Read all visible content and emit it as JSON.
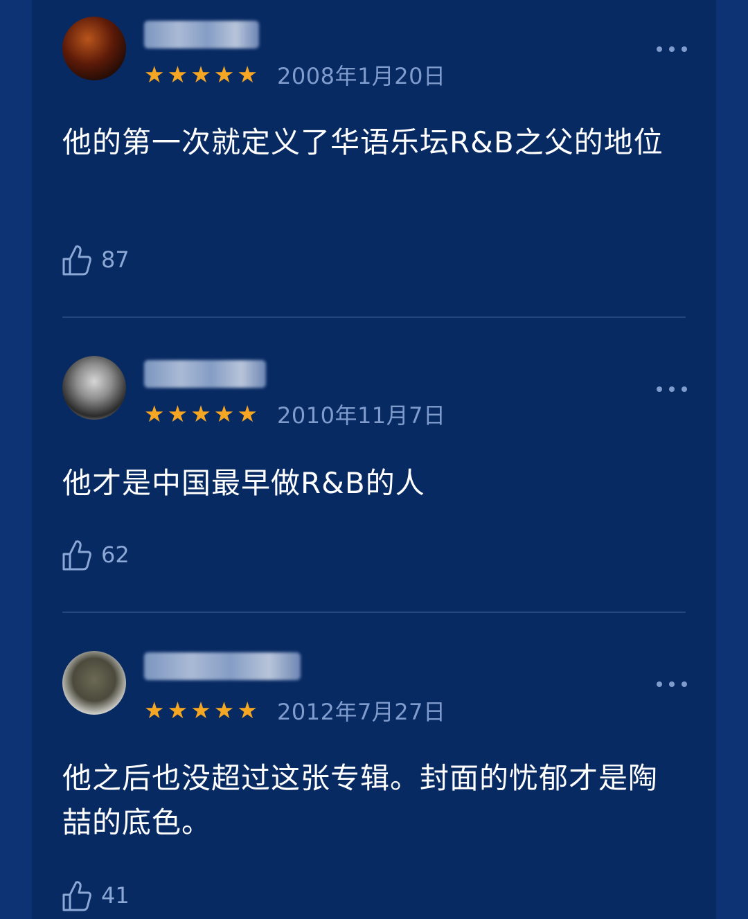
{
  "comments": [
    {
      "stars": 5,
      "date": "2008年1月20日",
      "text": "他的第一次就定义了华语乐坛R&B之父的地位",
      "likes": "87"
    },
    {
      "stars": 5,
      "date": "2010年11月7日",
      "text": "他才是中国最早做R&B的人",
      "likes": "62"
    },
    {
      "stars": 5,
      "date": "2012年7月27日",
      "text": "他之后也没超过这张专辑。封面的忧郁才是陶喆的底色。",
      "likes": "41"
    }
  ],
  "colors": {
    "background": "#082a63",
    "star": "#f5a623",
    "meta_text": "#7f9ccd",
    "body_text": "#ffffff",
    "divider": "#24477f"
  },
  "icons": {
    "rating": "star-icon",
    "like": "thumbs-up-icon",
    "menu": "more-horizontal-icon"
  }
}
